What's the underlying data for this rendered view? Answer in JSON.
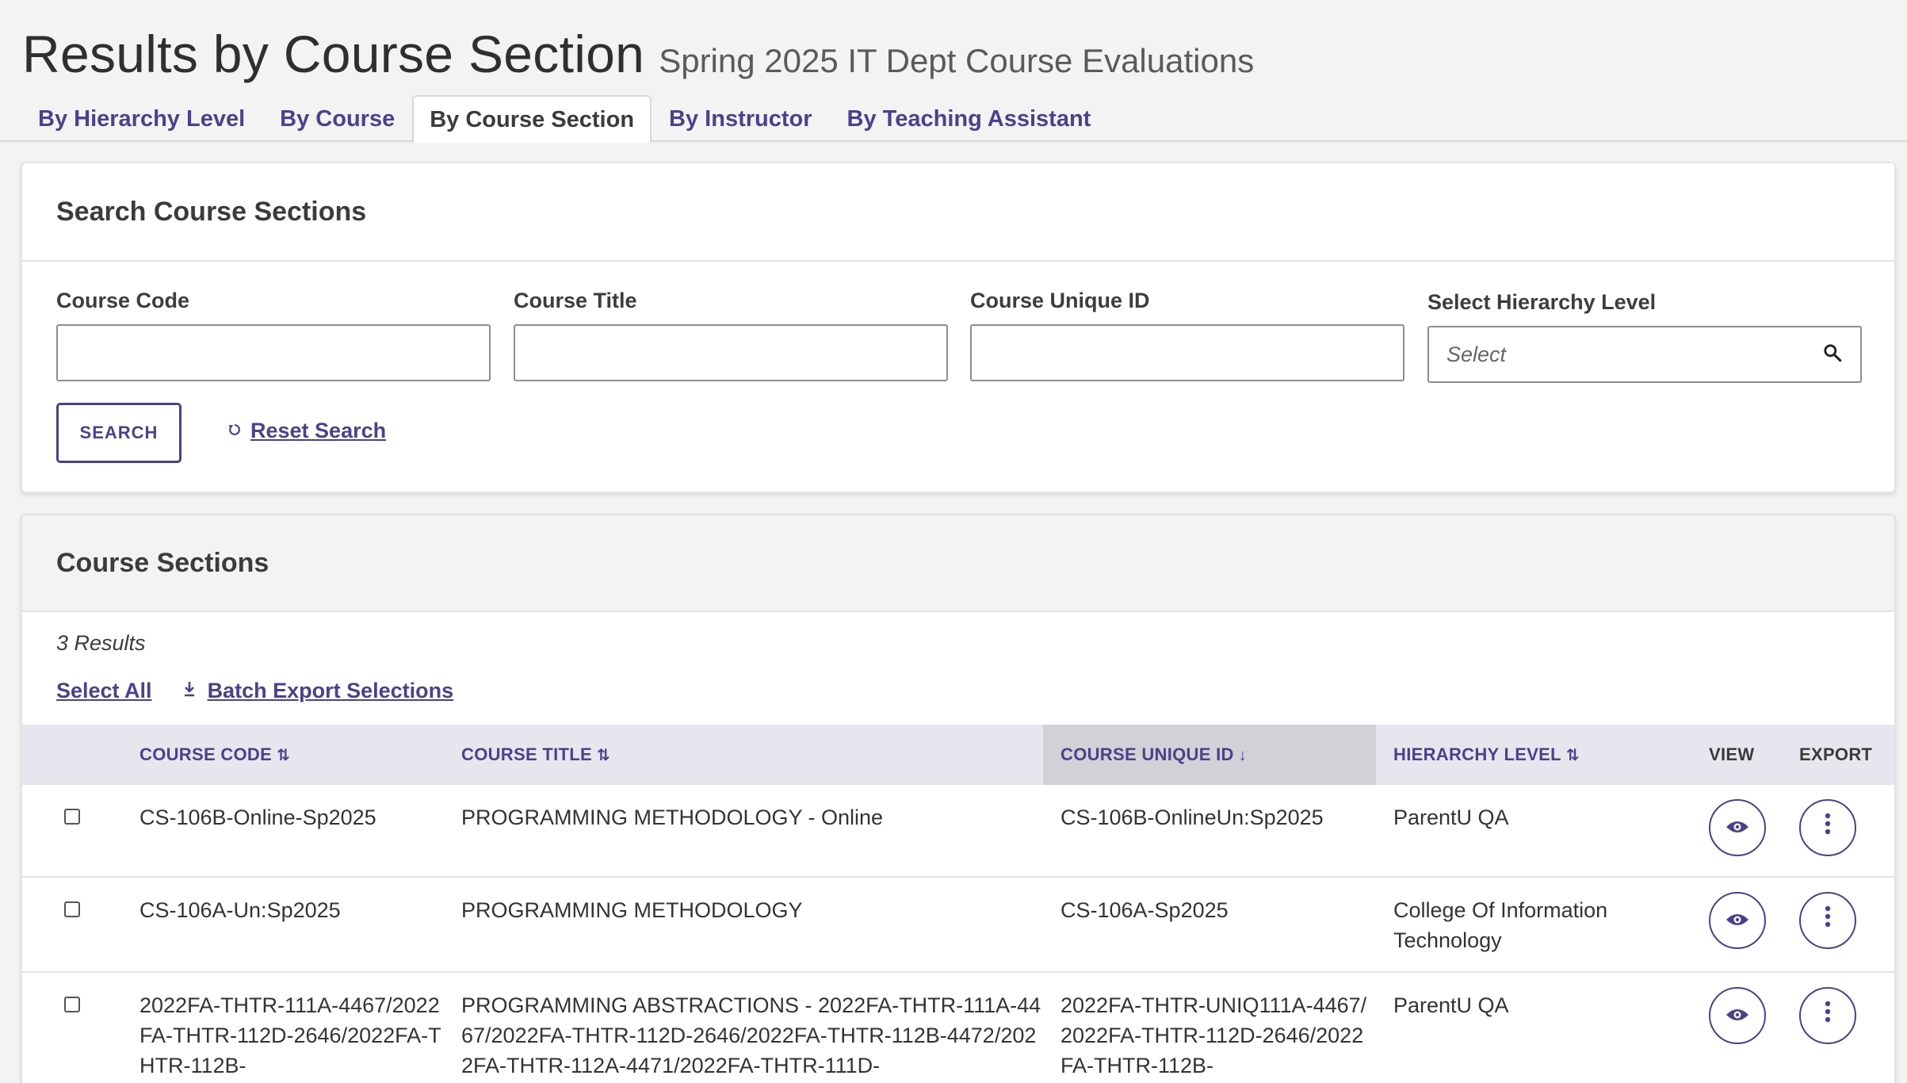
{
  "header": {
    "title": "Results by Course Section",
    "subtitle": "Spring 2025 IT Dept Course Evaluations"
  },
  "tabs": [
    {
      "label": "By Hierarchy Level",
      "active": false
    },
    {
      "label": "By Course",
      "active": false
    },
    {
      "label": "By Course Section",
      "active": true
    },
    {
      "label": "By Instructor",
      "active": false
    },
    {
      "label": "By Teaching Assistant",
      "active": false
    }
  ],
  "search": {
    "title": "Search Course Sections",
    "course_code_label": "Course Code",
    "course_code_value": "",
    "course_title_label": "Course Title",
    "course_title_value": "",
    "course_unique_id_label": "Course Unique ID",
    "course_unique_id_value": "",
    "hierarchy_label": "Select Hierarchy Level",
    "hierarchy_placeholder": "Select",
    "search_button": "SEARCH",
    "reset_link": "Reset Search"
  },
  "results": {
    "title": "Course Sections",
    "count_text": "3 Results",
    "select_all": "Select All",
    "batch_export": "Batch Export Selections",
    "columns": {
      "course_code": "COURSE CODE",
      "course_title": "COURSE TITLE",
      "course_unique_id": "COURSE UNIQUE ID",
      "hierarchy_level": "HIERARCHY LEVEL",
      "view": "VIEW",
      "export": "EXPORT"
    },
    "rows": [
      {
        "code": "CS-106B-Online-Sp2025",
        "title": "PROGRAMMING METHODOLOGY - Online",
        "unique_id": "CS-106B-OnlineUn:Sp2025",
        "hierarchy": "ParentU QA"
      },
      {
        "code": "CS-106A-Un:Sp2025",
        "title": "PROGRAMMING METHODOLOGY",
        "unique_id": "CS-106A-Sp2025",
        "hierarchy": "College Of Information Technology"
      },
      {
        "code": "2022FA-THTR-111A-4467/2022FA-THTR-112D-2646/2022FA-THTR-112B-",
        "title": "PROGRAMMING ABSTRACTIONS - 2022FA-THTR-111A-4467/2022FA-THTR-112D-2646/2022FA-THTR-112B-4472/2022FA-THTR-112A-4471/2022FA-THTR-111D-",
        "unique_id": "2022FA-THTR-UNIQ111A-4467/2022FA-THTR-112D-2646/2022FA-THTR-112B-",
        "hierarchy": "ParentU QA"
      }
    ]
  },
  "colors": {
    "accent": "#4a4289",
    "background": "#f3f3f3",
    "header_row": "#e7e6ee",
    "sorted_header": "#d2d1d7"
  }
}
